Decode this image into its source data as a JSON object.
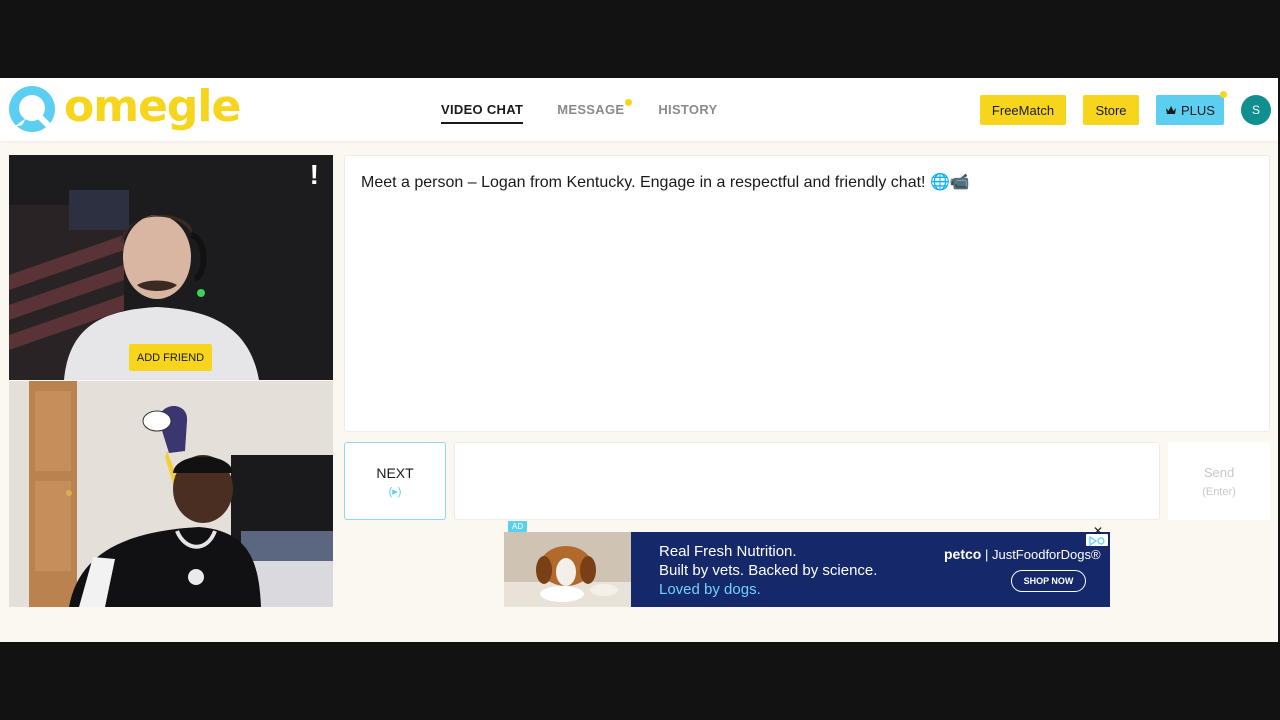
{
  "app": {
    "logo_text": "omegle",
    "colors": {
      "brand_yellow": "#f7d51d",
      "accent_cyan": "#5ccff1",
      "avatar_teal": "#0f8f8f",
      "ad_navy": "#15286a"
    }
  },
  "nav": {
    "tabs": [
      {
        "label": "VIDEO CHAT",
        "active": true
      },
      {
        "label": "MESSAGE",
        "has_notification": true
      },
      {
        "label": "HISTORY"
      }
    ]
  },
  "header_actions": {
    "freematch_label": "FreeMatch",
    "store_label": "Store",
    "plus_label": "PLUS",
    "plus_icon": "crown-icon",
    "avatar_initial": "S"
  },
  "video": {
    "report_label": "!",
    "add_friend_label": "ADD FRIEND"
  },
  "chat": {
    "intro_message": "Meet a person – Logan from Kentucky. Engage in a respectful and friendly chat!",
    "intro_emoji": "🌐📹",
    "message_value": "",
    "next_label": "NEXT",
    "next_hint": "(▸)",
    "send_label": "Send",
    "send_hint": "(Enter)"
  },
  "ad": {
    "tag": "AD",
    "line1": "Real Fresh Nutrition.",
    "line2": "Built by vets. Backed by science.",
    "line3": "Loved by dogs.",
    "brand": "petco",
    "brand_tagline": "JustFoodforDogs®",
    "cta": "SHOP NOW",
    "close_label": "✕"
  }
}
